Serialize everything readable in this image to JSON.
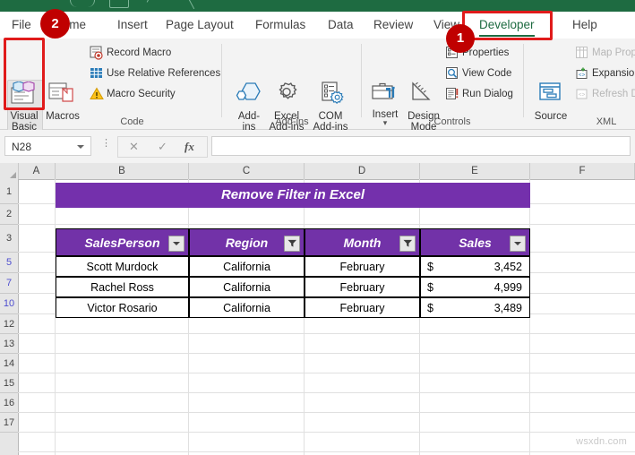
{
  "app": {
    "quick_access": [
      "save-icon",
      "workbook-icon",
      "undo-icon",
      "redo-icon"
    ]
  },
  "ribbon": {
    "tabs": [
      {
        "label": "File",
        "active": false
      },
      {
        "label": "Home",
        "active": false
      },
      {
        "label": "Insert",
        "active": false
      },
      {
        "label": "Page Layout",
        "active": false
      },
      {
        "label": "Formulas",
        "active": false
      },
      {
        "label": "Data",
        "active": false
      },
      {
        "label": "Review",
        "active": false
      },
      {
        "label": "View",
        "active": false
      },
      {
        "label": "Developer",
        "active": true
      },
      {
        "label": "Help",
        "active": false
      }
    ],
    "groups": [
      {
        "name": "Code",
        "big_buttons": [
          {
            "label": "Visual\nBasic",
            "icon": "visual-basic-icon",
            "highlighted": true
          },
          {
            "label": "Macros",
            "icon": "macros-icon",
            "highlighted": false
          }
        ],
        "small_buttons": [
          {
            "label": "Record Macro",
            "icon": "record-macro-icon",
            "disabled": false
          },
          {
            "label": "Use Relative References",
            "icon": "relative-refs-icon",
            "disabled": false
          },
          {
            "label": "Macro Security",
            "icon": "macro-security-icon",
            "disabled": false
          }
        ]
      },
      {
        "name": "Add-ins",
        "big_buttons": [
          {
            "label": "Add-\nins",
            "icon": "add-ins-icon",
            "highlighted": false
          },
          {
            "label": "Excel\nAdd-ins",
            "icon": "excel-add-ins-icon",
            "highlighted": false
          },
          {
            "label": "COM\nAdd-ins",
            "icon": "com-add-ins-icon",
            "highlighted": false
          }
        ],
        "small_buttons": []
      },
      {
        "name": "Controls",
        "big_buttons": [
          {
            "label": "Insert",
            "icon": "insert-control-icon",
            "highlighted": false
          },
          {
            "label": "Design\nMode",
            "icon": "design-mode-icon",
            "highlighted": false
          }
        ],
        "small_buttons": [
          {
            "label": "Properties",
            "icon": "properties-icon",
            "disabled": false
          },
          {
            "label": "View Code",
            "icon": "view-code-icon",
            "disabled": false
          },
          {
            "label": "Run Dialog",
            "icon": "run-dialog-icon",
            "disabled": false
          }
        ]
      },
      {
        "name": "XML",
        "big_buttons": [
          {
            "label": "Source",
            "icon": "xml-source-icon",
            "highlighted": false
          }
        ],
        "small_buttons": [
          {
            "label": "Map Properties",
            "icon": "map-properties-icon",
            "disabled": true
          },
          {
            "label": "Expansion Packs",
            "icon": "expansion-packs-icon",
            "disabled": false
          },
          {
            "label": "Refresh Data",
            "icon": "refresh-data-icon",
            "disabled": true
          }
        ]
      }
    ]
  },
  "annotations": [
    {
      "badge": "1",
      "target": "developer-tab"
    },
    {
      "badge": "2",
      "target": "visual-basic-button"
    }
  ],
  "formula_bar": {
    "name_box": "N28",
    "cancel_icon": "cancel-icon",
    "enter_icon": "enter-icon",
    "function_icon": "insert-function-icon",
    "formula": ""
  },
  "sheet": {
    "columns": [
      "A",
      "B",
      "C",
      "D",
      "E",
      "F"
    ],
    "row_numbers": [
      "1",
      "2",
      "3",
      "5",
      "7",
      "10",
      "12",
      "13",
      "14",
      "15",
      "16",
      "17"
    ],
    "filtered_rows": [
      "5",
      "7",
      "10"
    ],
    "title": "Remove Filter in Excel",
    "title_bg": "#7430ac",
    "header_bg": "#7232a8",
    "table": {
      "headers": [
        {
          "label": "SalesPerson",
          "filter_state": "dropdown"
        },
        {
          "label": "Region",
          "filter_state": "filtered"
        },
        {
          "label": "Month",
          "filter_state": "filtered"
        },
        {
          "label": "Sales",
          "filter_state": "dropdown"
        }
      ],
      "rows": [
        {
          "salesperson": "Scott Murdock",
          "region": "California",
          "month": "February",
          "currency": "$",
          "sales": "3,452"
        },
        {
          "salesperson": "Rachel Ross",
          "region": "California",
          "month": "February",
          "currency": "$",
          "sales": "4,999"
        },
        {
          "salesperson": "Victor Rosario",
          "region": "California",
          "month": "February",
          "currency": "$",
          "sales": "3,489"
        }
      ]
    }
  },
  "watermark": "wsxdn.com"
}
